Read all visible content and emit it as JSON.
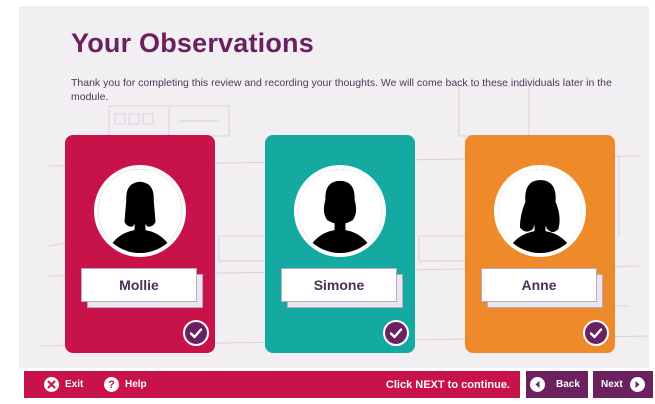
{
  "page": {
    "title": "Your Observations",
    "intro": "Thank you for completing this review and recording your thoughts. We will come back to these individuals later in the module."
  },
  "cards": [
    {
      "name": "Mollie",
      "color": "#c8124a",
      "avatar_icon": "female-silhouette-icon",
      "status_icon": "check-icon"
    },
    {
      "name": "Simone",
      "color": "#14aaa2",
      "avatar_icon": "female-silhouette-icon",
      "status_icon": "check-icon"
    },
    {
      "name": "Anne",
      "color": "#ee8a2a",
      "avatar_icon": "female-silhouette-icon",
      "status_icon": "check-icon"
    }
  ],
  "footer": {
    "exit_label": "Exit",
    "help_label": "Help",
    "help_icon_glyph": "?",
    "continue_text": "Click NEXT to continue.",
    "back_label": "Back",
    "next_label": "Next"
  },
  "colors": {
    "accent": "#6b2060",
    "footer_bar": "#c8124a",
    "background": "#f2eff3"
  }
}
